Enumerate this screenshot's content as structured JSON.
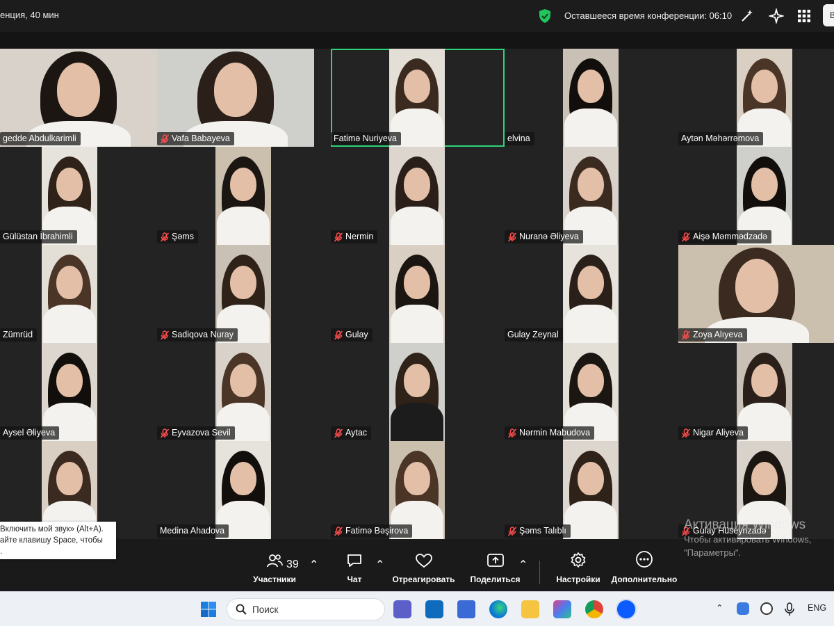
{
  "topbar": {
    "title": "енция, 40 мин",
    "remaining_label": "Оставшееся время конференции: 06:10",
    "view_label": "В",
    "shield_color": "#22c55e"
  },
  "participants": [
    {
      "name": "gedde Abdulkarimli",
      "muted": false,
      "active": false
    },
    {
      "name": "Vafa Babayeva",
      "muted": true,
      "active": false
    },
    {
      "name": "Fatimə Nuriyeva",
      "muted": false,
      "active": true
    },
    {
      "name": "elvina",
      "muted": false,
      "active": false
    },
    {
      "name": "Aytən Məhərrəmova",
      "muted": false,
      "active": false
    },
    {
      "name": "Gülüstan İbrahimli",
      "muted": false,
      "active": false
    },
    {
      "name": "Şəms",
      "muted": true,
      "active": false
    },
    {
      "name": "Nermin",
      "muted": true,
      "active": false
    },
    {
      "name": "Nuranə Əliyeva",
      "muted": true,
      "active": false
    },
    {
      "name": "Aişə Məmmədzadə",
      "muted": true,
      "active": false
    },
    {
      "name": "Zümrüd",
      "muted": false,
      "active": false
    },
    {
      "name": "Sadiqova Nuray",
      "muted": true,
      "active": false
    },
    {
      "name": "Gulay",
      "muted": true,
      "active": false
    },
    {
      "name": "Gulay Zeynal",
      "muted": false,
      "active": false
    },
    {
      "name": "Zoya Alıyeva",
      "muted": true,
      "active": false
    },
    {
      "name": "Aysel Əliyeva",
      "muted": false,
      "active": false
    },
    {
      "name": "Eyvazova Sevil",
      "muted": true,
      "active": false
    },
    {
      "name": "Aytac",
      "muted": true,
      "active": false
    },
    {
      "name": "Nərmin Mabudova",
      "muted": true,
      "active": false
    },
    {
      "name": "Nigar Aliyeva",
      "muted": true,
      "active": false
    },
    {
      "name": "",
      "muted": false,
      "active": false
    },
    {
      "name": "Medina Ahadova",
      "muted": false,
      "active": false
    },
    {
      "name": "Fatimə Bəşirova",
      "muted": true,
      "active": false
    },
    {
      "name": "Şəms Talıblı",
      "muted": true,
      "active": false
    },
    {
      "name": "Gulay Hüseynzadə",
      "muted": true,
      "active": false
    }
  ],
  "tooltip": {
    "line1": "Включить мой звук» (Alt+A).",
    "line2": "айте клавишу Space, чтобы",
    "line3": "."
  },
  "toolbar": {
    "participants_label": "Участники",
    "participants_count": "39",
    "chat_label": "Чат",
    "react_label": "Отреагировать",
    "share_label": "Поделиться",
    "settings_label": "Настройки",
    "more_label": "Дополнительно"
  },
  "watermark": {
    "line1": "Активация Windows",
    "line2": "Чтобы активировать Windows,",
    "line3": "\"Параметры\"."
  },
  "taskbar": {
    "search_placeholder": "Поиск",
    "lang": "ENG"
  }
}
